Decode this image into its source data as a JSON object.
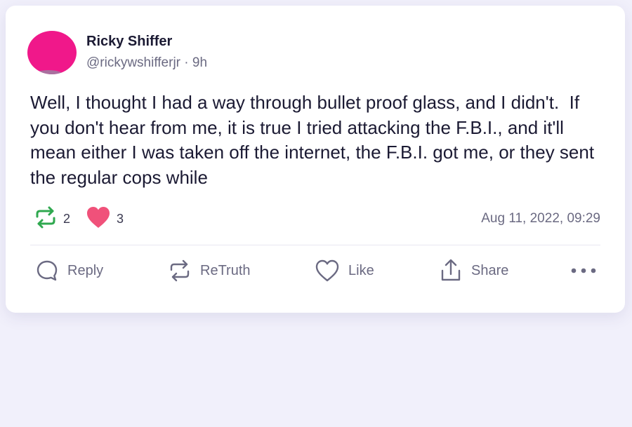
{
  "post": {
    "author_name": "Ricky Shiffer",
    "author_meta": "@rickywshifferjr · 9h",
    "text": "Well, I thought I had a way through bullet proof glass, and I didn't.  If you don't hear from me, it is true I tried attacking the F.B.I., and it'll mean either I was taken off the internet, the F.B.I. got me, or they sent the regular cops while",
    "retruth_count": "2",
    "like_count": "3",
    "timestamp": "Aug 11, 2022, 09:29"
  },
  "actions": {
    "reply_label": "Reply",
    "retruth_label": "ReTruth",
    "like_label": "Like",
    "share_label": "Share"
  },
  "icons": {
    "retruth_stat_icon": "retruth-icon",
    "like_stat_icon": "heart-icon",
    "reply_icon": "comment-bubble-icon",
    "retruth_icon": "retruth-icon",
    "like_icon": "heart-outline-icon",
    "share_icon": "share-upload-icon",
    "more_icon": "more-dots-icon"
  },
  "colors": {
    "retruth_green": "#2fa84f",
    "like_pink": "#f0517a",
    "avatar_pink": "#f0188a",
    "background": "#f1f0fb",
    "text_primary": "#1b1a33",
    "text_secondary": "#6b6a82"
  }
}
